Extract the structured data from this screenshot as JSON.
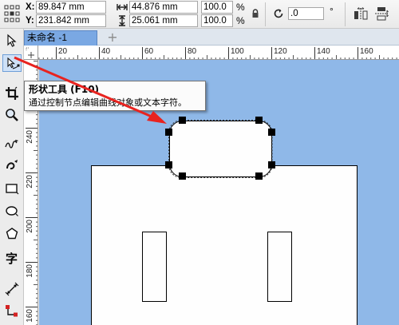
{
  "colors": {
    "canvas_background": "#8fb8e8",
    "active_tab": "#7aa8e3",
    "annotation_arrow": "#e8231f",
    "handle": "#000000"
  },
  "property_bar": {
    "x_label": "X:",
    "x_value": "89.847 mm",
    "y_label": "Y:",
    "y_value": "231.842 mm",
    "width_value": "44.876 mm",
    "height_value": "25.061 mm",
    "scale_x_value": "100.0",
    "scale_y_value": "100.0",
    "percent_symbol": "%",
    "rotation_value": ".0",
    "degree_symbol": "°",
    "icons": [
      "object-origin-icon",
      "width-icon",
      "height-icon",
      "lock-ratio-icon",
      "rotate-icon",
      "mirror-horizontal-icon",
      "mirror-vertical-icon"
    ]
  },
  "document_tab": {
    "label": "未命名 -1",
    "add_icon": "+"
  },
  "toolbox": {
    "tools": [
      "pick-tool-icon",
      "shape-tool-icon",
      "crop-tool-icon",
      "zoom-tool-icon",
      "freehand-tool-icon",
      "smart-drawing-icon",
      "rectangle-tool-icon",
      "ellipse-tool-icon",
      "polygon-tool-icon",
      "text-tool-icon",
      "dimension-tool-icon",
      "connector-tool-icon"
    ],
    "active_tool": "shape-tool-icon",
    "text_tool_glyph": "字"
  },
  "rulers": {
    "horizontal_ticks": [
      "20",
      "40",
      "60",
      "80",
      "100",
      "120",
      "140",
      "160"
    ],
    "vertical_ticks": [
      "240",
      "220",
      "200",
      "180",
      "160"
    ],
    "unit": "mm"
  },
  "tooltip": {
    "title": "形状工具 (F10)",
    "body": "通过控制节点编辑曲线对象或文本字符。"
  }
}
